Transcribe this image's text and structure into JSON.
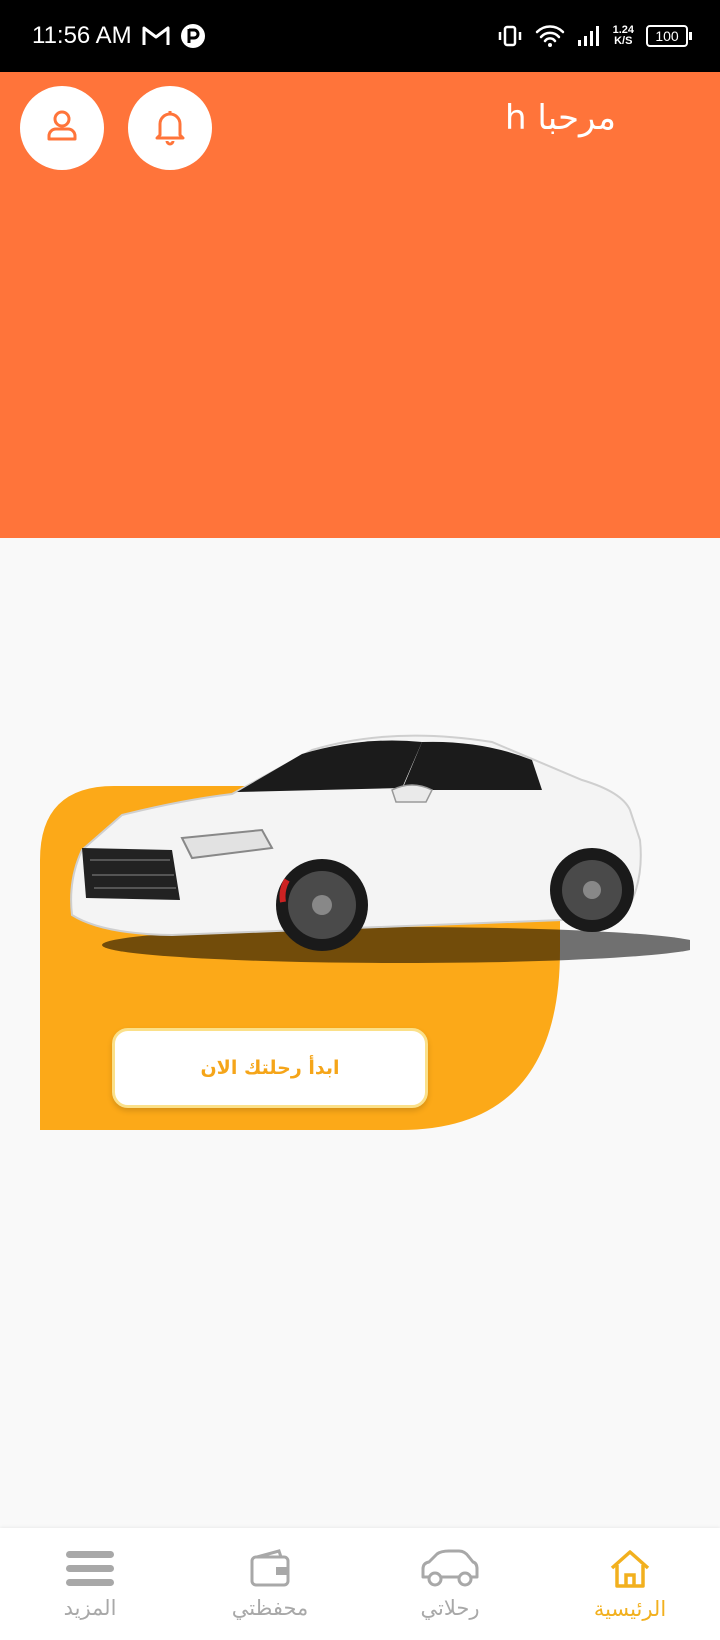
{
  "status_bar": {
    "time": "11:56 AM",
    "speed_top": "1.24",
    "speed_bottom": "K/S",
    "battery": "100"
  },
  "header": {
    "greeting": "مرحبا h",
    "icons": {
      "profile": "user-icon",
      "notifications": "bell-icon"
    }
  },
  "promo": {
    "cta_label": "ابدأ رحلتك الان",
    "image": "white-sports-car"
  },
  "bottom_nav": {
    "items": [
      {
        "label": "المزيد",
        "icon": "menu-icon"
      },
      {
        "label": "محفظتي",
        "icon": "wallet-icon"
      },
      {
        "label": "رحلاتي",
        "icon": "car-icon"
      },
      {
        "label": "الرئيسية",
        "icon": "home-icon",
        "active": true
      }
    ]
  },
  "colors": {
    "hero": "#ff743a",
    "card": "#fca918",
    "accent": "#f2b01e",
    "inactive": "#a8a8a8"
  }
}
